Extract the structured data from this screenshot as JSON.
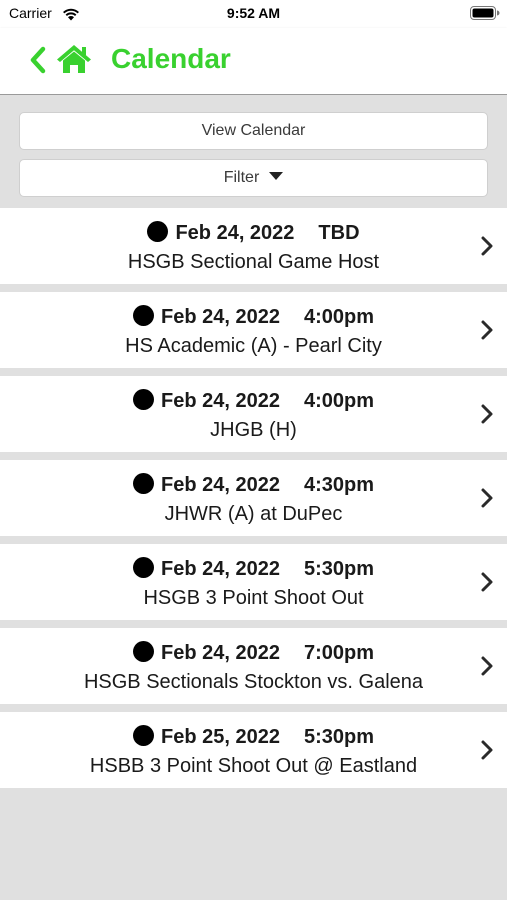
{
  "status_bar": {
    "carrier": "Carrier",
    "time": "9:52 AM",
    "icons": [
      "wifi-icon",
      "battery-icon"
    ]
  },
  "nav": {
    "title": "Calendar",
    "accent_color": "#39d12f",
    "icons": [
      "chevron-left-icon",
      "home-icon"
    ]
  },
  "controls": {
    "view_calendar_label": "View Calendar",
    "filter_label": "Filter"
  },
  "events": [
    {
      "date": "Feb 24, 2022",
      "time": "TBD",
      "title": "HSGB Sectional Game Host"
    },
    {
      "date": "Feb 24, 2022",
      "time": "4:00pm",
      "title": "HS Academic (A) - Pearl City"
    },
    {
      "date": "Feb 24, 2022",
      "time": "4:00pm",
      "title": "JHGB (H)"
    },
    {
      "date": "Feb 24, 2022",
      "time": "4:30pm",
      "title": "JHWR (A) at DuPec"
    },
    {
      "date": "Feb 24, 2022",
      "time": "5:30pm",
      "title": "HSGB 3 Point Shoot Out"
    },
    {
      "date": "Feb 24, 2022",
      "time": "7:00pm",
      "title": "HSGB Sectionals Stockton vs. Galena"
    },
    {
      "date": "Feb 25, 2022",
      "time": "5:30pm",
      "title": "HSBB 3 Point Shoot Out @ Eastland"
    }
  ]
}
